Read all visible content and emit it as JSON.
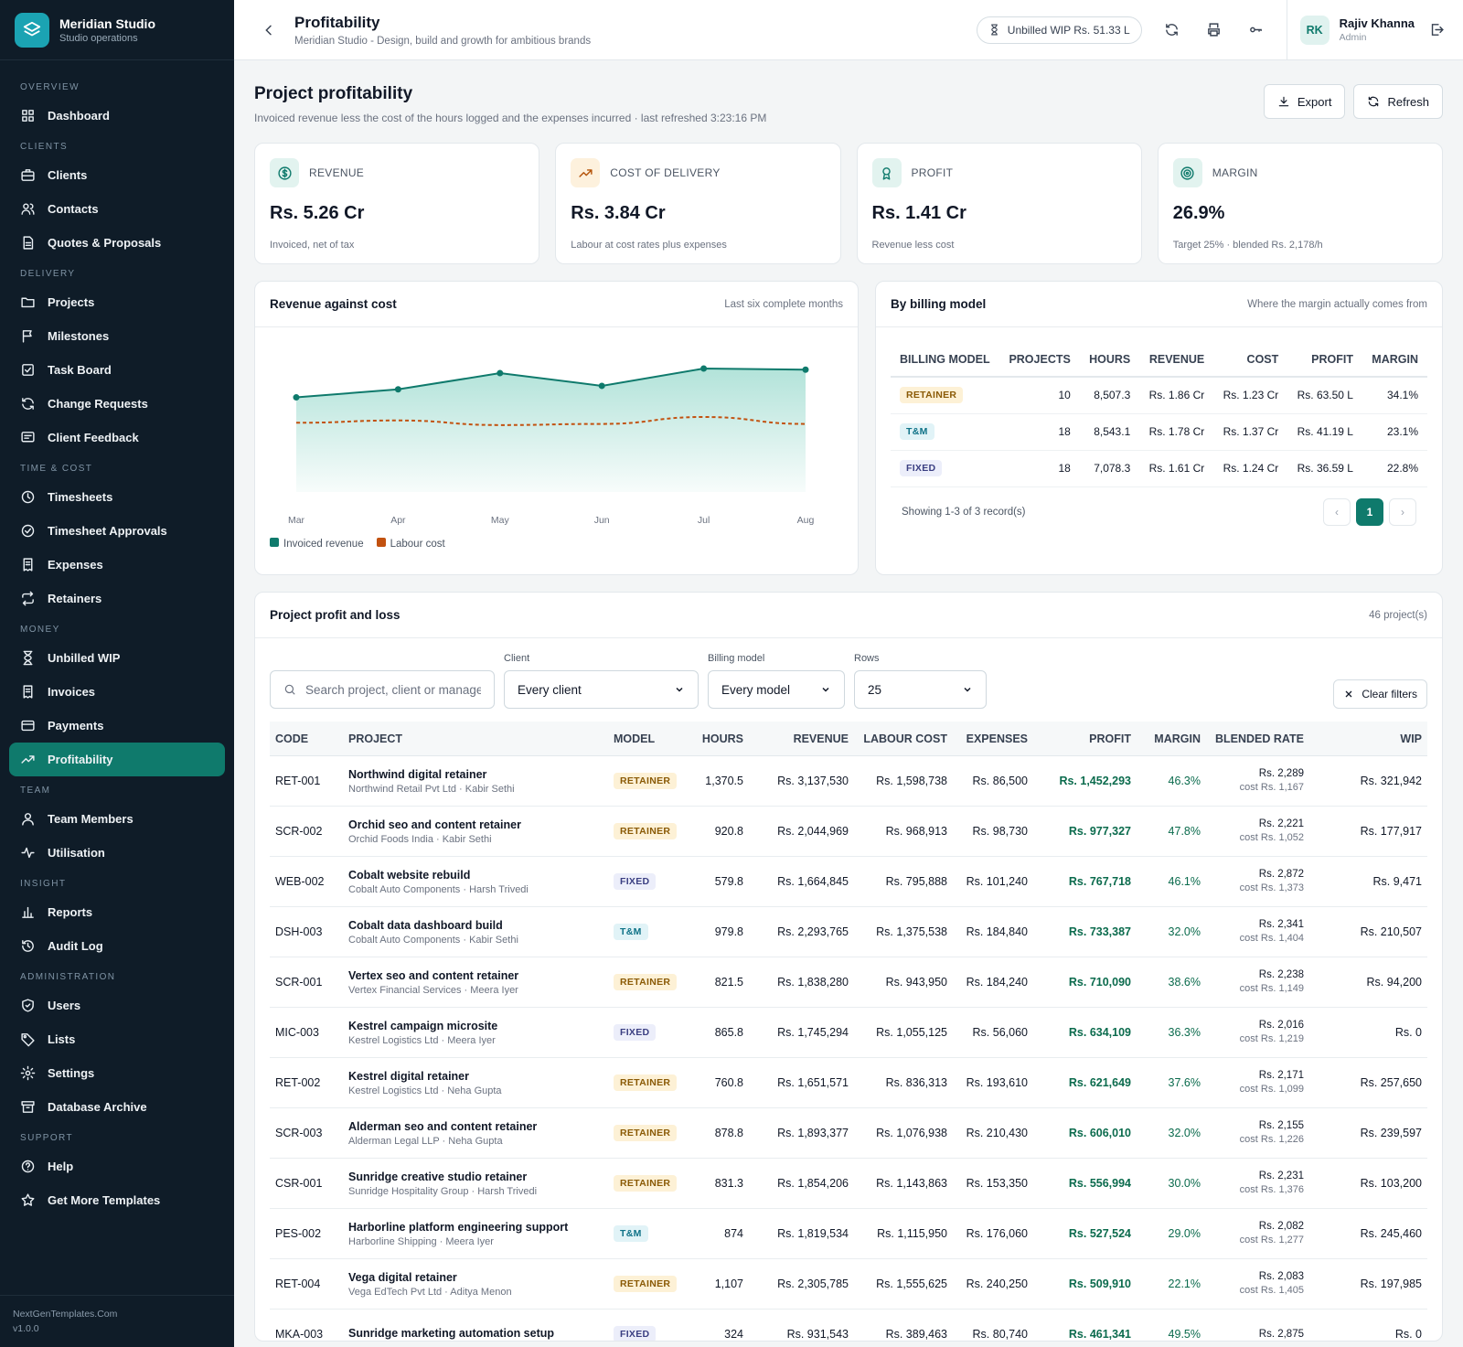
{
  "brand": {
    "name": "Meridian Studio",
    "sub": "Studio operations"
  },
  "nav": [
    {
      "section": "OVERVIEW",
      "items": [
        {
          "label": "Dashboard",
          "icon": "grid-icon"
        }
      ]
    },
    {
      "section": "CLIENTS",
      "items": [
        {
          "label": "Clients",
          "icon": "briefcase-icon"
        },
        {
          "label": "Contacts",
          "icon": "users-icon"
        },
        {
          "label": "Quotes & Proposals",
          "icon": "document-icon"
        }
      ]
    },
    {
      "section": "DELIVERY",
      "items": [
        {
          "label": "Projects",
          "icon": "folder-icon"
        },
        {
          "label": "Milestones",
          "icon": "flag-icon"
        },
        {
          "label": "Task Board",
          "icon": "checkbox-icon"
        },
        {
          "label": "Change Requests",
          "icon": "refresh-icon"
        },
        {
          "label": "Client Feedback",
          "icon": "message-icon"
        }
      ]
    },
    {
      "section": "TIME & COST",
      "items": [
        {
          "label": "Timesheets",
          "icon": "clock-icon"
        },
        {
          "label": "Timesheet Approvals",
          "icon": "check-circle-icon"
        },
        {
          "label": "Expenses",
          "icon": "receipt-icon"
        },
        {
          "label": "Retainers",
          "icon": "repeat-icon"
        }
      ]
    },
    {
      "section": "MONEY",
      "items": [
        {
          "label": "Unbilled WIP",
          "icon": "hourglass-icon"
        },
        {
          "label": "Invoices",
          "icon": "receipt-icon"
        },
        {
          "label": "Payments",
          "icon": "card-icon"
        },
        {
          "label": "Profitability",
          "icon": "trending-icon",
          "active": true
        }
      ]
    },
    {
      "section": "TEAM",
      "items": [
        {
          "label": "Team Members",
          "icon": "user-icon"
        },
        {
          "label": "Utilisation",
          "icon": "pulse-icon"
        }
      ]
    },
    {
      "section": "INSIGHT",
      "items": [
        {
          "label": "Reports",
          "icon": "bar-chart-icon"
        },
        {
          "label": "Audit Log",
          "icon": "history-icon"
        }
      ]
    },
    {
      "section": "ADMINISTRATION",
      "items": [
        {
          "label": "Users",
          "icon": "shield-icon"
        },
        {
          "label": "Lists",
          "icon": "tag-icon"
        },
        {
          "label": "Settings",
          "icon": "gear-icon"
        },
        {
          "label": "Database Archive",
          "icon": "archive-icon"
        }
      ]
    },
    {
      "section": "SUPPORT",
      "items": [
        {
          "label": "Help",
          "icon": "help-icon"
        },
        {
          "label": "Get More Templates",
          "icon": "star-icon"
        }
      ]
    }
  ],
  "footer": {
    "site": "NextGenTemplates.Com",
    "version": "v1.0.0"
  },
  "topbar": {
    "title": "Profitability",
    "subtitle": "Meridian Studio - Design, build and growth for ambitious brands",
    "wip": "Unbilled WIP Rs. 51.33 L",
    "user": {
      "initials": "RK",
      "name": "Rajiv Khanna",
      "role": "Admin"
    }
  },
  "header": {
    "title": "Project profitability",
    "subtitle": "Invoiced revenue less the cost of the hours logged and the expenses incurred · last refreshed 3:23:16 PM",
    "export": "Export",
    "refresh": "Refresh"
  },
  "kpis": [
    {
      "label": "REVENUE",
      "value": "Rs. 5.26 Cr",
      "note": "Invoiced, net of tax",
      "icon": "dollar-icon",
      "color": "#0f7a6c",
      "bg": "#e2f3ef"
    },
    {
      "label": "COST OF DELIVERY",
      "value": "Rs. 3.84 Cr",
      "note": "Labour at cost rates plus expenses",
      "icon": "trending-up-icon",
      "color": "#b45309",
      "bg": "#fdf1dd"
    },
    {
      "label": "PROFIT",
      "value": "Rs. 1.41 Cr",
      "note": "Revenue less cost",
      "icon": "award-icon",
      "color": "#0f7a6c",
      "bg": "#e2f3ef"
    },
    {
      "label": "MARGIN",
      "value": "26.9%",
      "note": "Target 25% · blended Rs. 2,178/h",
      "icon": "target-icon",
      "color": "#0f7a6c",
      "bg": "#e2f3ef"
    }
  ],
  "revenue_chart": {
    "title": "Revenue against cost",
    "note": "Last six complete months"
  },
  "chart_data": {
    "type": "area",
    "categories": [
      "Mar",
      "Apr",
      "May",
      "Jun",
      "Jul",
      "Aug"
    ],
    "series": [
      {
        "name": "Invoiced revenue",
        "values": [
          82,
          89,
          103,
          92,
          107,
          106
        ],
        "color": "#0f7a6c"
      },
      {
        "name": "Labour cost",
        "values": [
          60,
          62,
          58,
          59,
          65,
          59
        ],
        "color": "#c2510f"
      }
    ],
    "ylim": [
      0,
      130
    ],
    "grid": false,
    "legend": "bottom-left"
  },
  "billing": {
    "title": "By billing model",
    "note": "Where the margin actually comes from",
    "columns": [
      "BILLING MODEL",
      "PROJECTS",
      "HOURS",
      "REVENUE",
      "COST",
      "PROFIT",
      "MARGIN"
    ],
    "rows": [
      [
        "RETAINER",
        "10",
        "8,507.3",
        "Rs. 1.86 Cr",
        "Rs. 1.23 Cr",
        "Rs. 63.50 L",
        "34.1%"
      ],
      [
        "T&M",
        "18",
        "8,543.1",
        "Rs. 1.78 Cr",
        "Rs. 1.37 Cr",
        "Rs. 41.19 L",
        "23.1%"
      ],
      [
        "FIXED",
        "18",
        "7,078.3",
        "Rs. 1.61 Cr",
        "Rs. 1.24 Cr",
        "Rs. 36.59 L",
        "22.8%"
      ]
    ],
    "showing": "Showing 1-3 of 3 record(s)",
    "page": "1"
  },
  "pl": {
    "title": "Project profit and loss",
    "count": "46 project(s)",
    "filters": {
      "search_placeholder": "Search project, client or manager",
      "client_label": "Client",
      "client": "Every client",
      "model_label": "Billing model",
      "model": "Every model",
      "rows_label": "Rows",
      "rows": "25",
      "clear": "Clear filters"
    },
    "columns": [
      "CODE",
      "PROJECT",
      "MODEL",
      "HOURS",
      "REVENUE",
      "LABOUR COST",
      "EXPENSES",
      "PROFIT",
      "MARGIN",
      "BLENDED RATE",
      "WIP"
    ],
    "rows": [
      [
        "RET-001",
        "Northwind digital retainer",
        "Northwind Retail Pvt Ltd · Kabir Sethi",
        "RETAINER",
        "1,370.5",
        "Rs. 3,137,530",
        "Rs. 1,598,738",
        "Rs. 86,500",
        "Rs. 1,452,293",
        "46.3%",
        "Rs. 2,289",
        "cost Rs. 1,167",
        "Rs. 321,942"
      ],
      [
        "SCR-002",
        "Orchid seo and content retainer",
        "Orchid Foods India · Kabir Sethi",
        "RETAINER",
        "920.8",
        "Rs. 2,044,969",
        "Rs. 968,913",
        "Rs. 98,730",
        "Rs. 977,327",
        "47.8%",
        "Rs. 2,221",
        "cost Rs. 1,052",
        "Rs. 177,917"
      ],
      [
        "WEB-002",
        "Cobalt website rebuild",
        "Cobalt Auto Components · Harsh Trivedi",
        "FIXED",
        "579.8",
        "Rs. 1,664,845",
        "Rs. 795,888",
        "Rs. 101,240",
        "Rs. 767,718",
        "46.1%",
        "Rs. 2,872",
        "cost Rs. 1,373",
        "Rs. 9,471"
      ],
      [
        "DSH-003",
        "Cobalt data dashboard build",
        "Cobalt Auto Components · Kabir Sethi",
        "T&M",
        "979.8",
        "Rs. 2,293,765",
        "Rs. 1,375,538",
        "Rs. 184,840",
        "Rs. 733,387",
        "32.0%",
        "Rs. 2,341",
        "cost Rs. 1,404",
        "Rs. 210,507"
      ],
      [
        "SCR-001",
        "Vertex seo and content retainer",
        "Vertex Financial Services · Meera Iyer",
        "RETAINER",
        "821.5",
        "Rs. 1,838,280",
        "Rs. 943,950",
        "Rs. 184,240",
        "Rs. 710,090",
        "38.6%",
        "Rs. 2,238",
        "cost Rs. 1,149",
        "Rs. 94,200"
      ],
      [
        "MIC-003",
        "Kestrel campaign microsite",
        "Kestrel Logistics Ltd · Meera Iyer",
        "FIXED",
        "865.8",
        "Rs. 1,745,294",
        "Rs. 1,055,125",
        "Rs. 56,060",
        "Rs. 634,109",
        "36.3%",
        "Rs. 2,016",
        "cost Rs. 1,219",
        "Rs. 0"
      ],
      [
        "RET-002",
        "Kestrel digital retainer",
        "Kestrel Logistics Ltd · Neha Gupta",
        "RETAINER",
        "760.8",
        "Rs. 1,651,571",
        "Rs. 836,313",
        "Rs. 193,610",
        "Rs. 621,649",
        "37.6%",
        "Rs. 2,171",
        "cost Rs. 1,099",
        "Rs. 257,650"
      ],
      [
        "SCR-003",
        "Alderman seo and content retainer",
        "Alderman Legal LLP · Neha Gupta",
        "RETAINER",
        "878.8",
        "Rs. 1,893,377",
        "Rs. 1,076,938",
        "Rs. 210,430",
        "Rs. 606,010",
        "32.0%",
        "Rs. 2,155",
        "cost Rs. 1,226",
        "Rs. 239,597"
      ],
      [
        "CSR-001",
        "Sunridge creative studio retainer",
        "Sunridge Hospitality Group · Harsh Trivedi",
        "RETAINER",
        "831.3",
        "Rs. 1,854,206",
        "Rs. 1,143,863",
        "Rs. 153,350",
        "Rs. 556,994",
        "30.0%",
        "Rs. 2,231",
        "cost Rs. 1,376",
        "Rs. 103,200"
      ],
      [
        "PES-002",
        "Harborline platform engineering support",
        "Harborline Shipping · Meera Iyer",
        "T&M",
        "874",
        "Rs. 1,819,534",
        "Rs. 1,115,950",
        "Rs. 176,060",
        "Rs. 527,524",
        "29.0%",
        "Rs. 2,082",
        "cost Rs. 1,277",
        "Rs. 245,460"
      ],
      [
        "RET-004",
        "Vega digital retainer",
        "Vega EdTech Pvt Ltd · Aditya Menon",
        "RETAINER",
        "1,107",
        "Rs. 2,305,785",
        "Rs. 1,555,625",
        "Rs. 240,250",
        "Rs. 509,910",
        "22.1%",
        "Rs. 2,083",
        "cost Rs. 1,405",
        "Rs. 197,985"
      ],
      [
        "MKA-003",
        "Sunridge marketing automation setup",
        "",
        "FIXED",
        "324",
        "Rs. 931,543",
        "Rs. 389,463",
        "Rs. 80,740",
        "Rs. 461,341",
        "49.5%",
        "Rs. 2,875",
        "",
        "Rs. 0"
      ]
    ]
  }
}
